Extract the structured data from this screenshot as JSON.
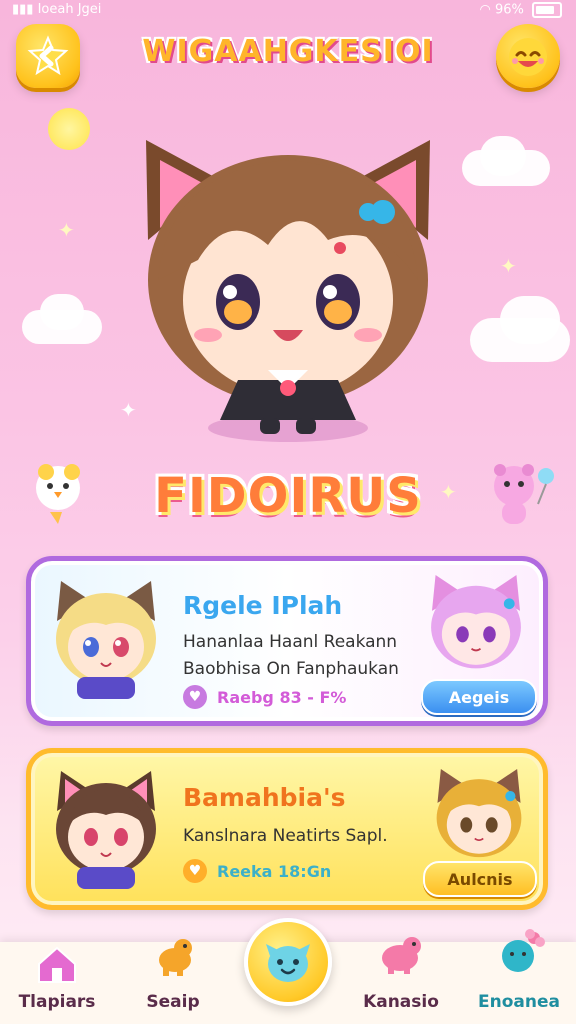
{
  "status_bar": {
    "left_text": "Ioeah Jgei",
    "battery": "96%"
  },
  "header": {
    "title": "WIGAAHGKESIOI"
  },
  "hero": {
    "name": "FIDOIRUS"
  },
  "cards": [
    {
      "title": "Rgele IPlah",
      "desc_line1": "Hananlaa Haanl Reakann",
      "desc_line2": "Baobhisa On Fanphaukan",
      "stat": "Raebg 83 - F%",
      "button": "Aegeis",
      "title_color": "#3aa7ef",
      "stat_color": "#d35bd8"
    },
    {
      "title": "Bamahbia's",
      "desc_line1": "Kanslnara Neatirts Sapl.",
      "stat": "Reeka 18:Gn",
      "button": "Aulcnis",
      "title_color": "#f0741e",
      "stat_color": "#3cb0c9"
    }
  ],
  "nav": [
    {
      "label": "Tlapiars",
      "icon": "house-icon"
    },
    {
      "label": "Seaip",
      "icon": "dog-icon"
    },
    {
      "label": "",
      "icon": "blue-pet-icon"
    },
    {
      "label": "Kanasio",
      "icon": "pink-pet-icon"
    },
    {
      "label": "Enoanea",
      "icon": "flower-pet-icon"
    }
  ]
}
